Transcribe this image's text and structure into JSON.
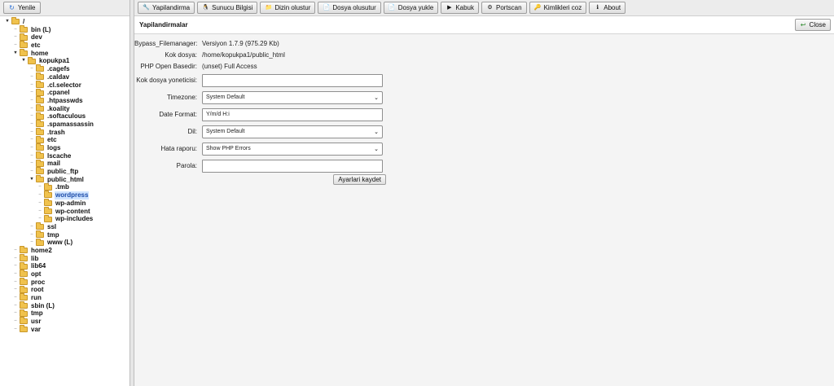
{
  "left_panel": {
    "refresh_label": "Yenile",
    "tree": [
      {
        "label": "/",
        "depth": 0,
        "expanded": true
      },
      {
        "label": "bin (L)",
        "depth": 1
      },
      {
        "label": "dev",
        "depth": 1
      },
      {
        "label": "etc",
        "depth": 1
      },
      {
        "label": "home",
        "depth": 1,
        "expanded": true
      },
      {
        "label": "kopukpa1",
        "depth": 2,
        "expanded": true
      },
      {
        "label": ".cagefs",
        "depth": 3
      },
      {
        "label": ".caldav",
        "depth": 3
      },
      {
        "label": ".cl.selector",
        "depth": 3
      },
      {
        "label": ".cpanel",
        "depth": 3
      },
      {
        "label": ".htpasswds",
        "depth": 3
      },
      {
        "label": ".koality",
        "depth": 3
      },
      {
        "label": ".softaculous",
        "depth": 3
      },
      {
        "label": ".spamassassin",
        "depth": 3
      },
      {
        "label": ".trash",
        "depth": 3
      },
      {
        "label": "etc",
        "depth": 3
      },
      {
        "label": "logs",
        "depth": 3
      },
      {
        "label": "lscache",
        "depth": 3
      },
      {
        "label": "mail",
        "depth": 3
      },
      {
        "label": "public_ftp",
        "depth": 3
      },
      {
        "label": "public_html",
        "depth": 3,
        "expanded": true
      },
      {
        "label": ".tmb",
        "depth": 4
      },
      {
        "label": "wordpress",
        "depth": 4,
        "selected": true
      },
      {
        "label": "wp-admin",
        "depth": 4
      },
      {
        "label": "wp-content",
        "depth": 4
      },
      {
        "label": "wp-includes",
        "depth": 4
      },
      {
        "label": "ssl",
        "depth": 3
      },
      {
        "label": "tmp",
        "depth": 3
      },
      {
        "label": "www (L)",
        "depth": 3
      },
      {
        "label": "home2",
        "depth": 1
      },
      {
        "label": "lib",
        "depth": 1
      },
      {
        "label": "lib64",
        "depth": 1
      },
      {
        "label": "opt",
        "depth": 1
      },
      {
        "label": "proc",
        "depth": 1
      },
      {
        "label": "root",
        "depth": 1
      },
      {
        "label": "run",
        "depth": 1
      },
      {
        "label": "sbin (L)",
        "depth": 1
      },
      {
        "label": "tmp",
        "depth": 1
      },
      {
        "label": "usr",
        "depth": 1
      },
      {
        "label": "var",
        "depth": 1
      }
    ]
  },
  "toolbar": {
    "buttons": [
      {
        "label": "Yapilandirma",
        "icon": "wrench-icon",
        "glyph": "🔧"
      },
      {
        "label": "Sunucu Bilgisi",
        "icon": "linux-icon",
        "glyph": "🐧"
      },
      {
        "label": "Dizin olustur",
        "icon": "folder-icon",
        "glyph": "📁"
      },
      {
        "label": "Dosya olusutur",
        "icon": "new-file-icon",
        "glyph": "📄"
      },
      {
        "label": "Dosya yukle",
        "icon": "upload-icon",
        "glyph": "📄"
      },
      {
        "label": "Kabuk",
        "icon": "shell-icon",
        "glyph": "▶"
      },
      {
        "label": "Portscan",
        "icon": "portscan-icon",
        "glyph": "⚙"
      },
      {
        "label": "Kimlikleri coz",
        "icon": "key-icon",
        "glyph": "🔑"
      },
      {
        "label": "About",
        "icon": "about-icon",
        "glyph": "ℹ"
      }
    ]
  },
  "panel": {
    "title": "Yapilandirmalar",
    "close_label": "Close",
    "info": {
      "filemanager_label": "Bypass_Filemanager:",
      "filemanager_value": "Versiyon 1.7.9 (975.29 Kb)",
      "root_label": "Kok dosya:",
      "root_value": "/home/kopukpa1/public_html",
      "basedir_label": "PHP Open Basedir:",
      "basedir_value": "(unset) Full Access"
    },
    "form": {
      "root_manager_label": "Kok dosya yoneticisi:",
      "root_manager_value": "",
      "timezone_label": "Timezone:",
      "timezone_value": "System Default",
      "date_format_label": "Date Format:",
      "date_format_value": "Y/m/d H:i",
      "language_label": "Dil:",
      "language_value": "System Default",
      "error_report_label": "Hata raporu:",
      "error_report_value": "Show PHP Errors",
      "password_label": "Parola:",
      "password_value": "",
      "save_label": "Ayarlari kaydet"
    }
  },
  "colors": {
    "selected_bg": "#cfe4ff",
    "folder": "#f0c24d",
    "toolbar_bg": "#ececec"
  }
}
